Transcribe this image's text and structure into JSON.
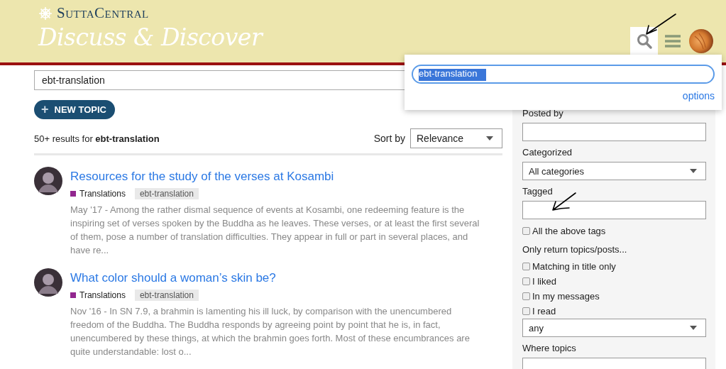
{
  "header": {
    "brand": "SuttaCentral",
    "title": "Discuss & Discover"
  },
  "search_popup": {
    "value": "ebt-translation",
    "text_selected": true,
    "options_link": "options"
  },
  "search": {
    "value": "ebt-translation"
  },
  "new_topic_button": {
    "icon": "+",
    "label": "NEW TOPIC"
  },
  "results_summary": "50+ results for **ebt-translation**",
  "sort": {
    "label": "Sort by",
    "value": "Relevance"
  },
  "results": [
    {
      "title": "Resources for the study of the verses at Kosambi",
      "category": "Translations",
      "color": "#92278f",
      "tag": "ebt-translation",
      "excerpt": "May '17 - Among the rather dismal sequence of events at Kosambi, one redeeming feature is the inspiring set of verses spoken by the Buddha as he leaves. These verses, or at least the first several of them, pose a number of translation difficulties. They appear in full or part in several places, and have re..."
    },
    {
      "title": "What color should a woman’s skin be?",
      "category": "Translations",
      "color": "#92278f",
      "tag": "ebt-translation",
      "excerpt": "Nov '16 - In SN 7.9, a brahmin is lamenting his ill luck, by comparison with the unencumbered freedom of the Buddha. The Buddha responds by agreeing point by point that he is, in fact, unencumbered by these things, at which the brahmin goes forth. Most of these encumbrances are quite understandable: lost o..."
    }
  ],
  "filters": [
    {
      "kind": "label",
      "text": "Posted by"
    },
    {
      "kind": "text_field"
    },
    {
      "kind": "label",
      "text": "Categorized"
    },
    {
      "kind": "select",
      "value": "All categories"
    },
    {
      "kind": "label",
      "text": "Tagged"
    },
    {
      "kind": "text_field"
    },
    {
      "kind": "checkbox",
      "text": "All the above tags",
      "checked": false
    },
    {
      "kind": "label",
      "text": "Only return topics/posts..."
    },
    {
      "kind": "checkbox",
      "text": "Matching in title only",
      "checked": false
    },
    {
      "kind": "checkbox",
      "text": "I liked",
      "checked": false
    },
    {
      "kind": "checkbox",
      "text": "In my messages",
      "checked": false
    },
    {
      "kind": "checkbox",
      "text": "I read",
      "checked": false
    },
    {
      "kind": "select",
      "value": "any"
    },
    {
      "kind": "label",
      "text": "Where topics"
    },
    {
      "kind": "text_field"
    }
  ]
}
